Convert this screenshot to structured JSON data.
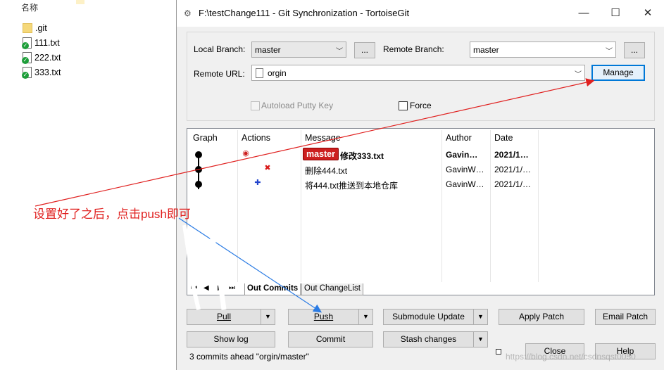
{
  "explorer": {
    "header": "名称",
    "items": [
      {
        "name": ".git",
        "icon": "folder-icon"
      },
      {
        "name": "111.txt",
        "icon": "txt-file-synced-icon"
      },
      {
        "name": "222.txt",
        "icon": "txt-file-synced-icon"
      },
      {
        "name": "333.txt",
        "icon": "txt-file-synced-icon"
      }
    ]
  },
  "dialog": {
    "title": "F:\\testChange111 - Git Synchronization - TortoiseGit",
    "local_branch_label": "Local Branch:",
    "local_branch_value": "master",
    "remote_branch_label": "Remote Branch:",
    "remote_branch_value": "master",
    "ellipsis": "...",
    "remote_url_label": "Remote URL:",
    "remote_url_value": "orgin",
    "manage_label": "Manage",
    "autoload_label": "Autoload Putty Key",
    "force_label": "Force",
    "columns": [
      "Graph",
      "Actions",
      "Message",
      "Author",
      "Date"
    ],
    "commits": [
      {
        "branch": "master",
        "message": "修改333.txt",
        "author": "Gavin…",
        "date": "2021/1…",
        "bold": true
      },
      {
        "branch": "",
        "message": "删除444.txt",
        "author": "GavinW…",
        "date": "2021/1/…",
        "bold": false
      },
      {
        "branch": "",
        "message": "将444.txt推送到本地仓库",
        "author": "GavinW…",
        "date": "2021/1/…",
        "bold": false
      }
    ],
    "tabs": {
      "out_commits": "Out Commits",
      "out_changelist": "Out ChangeList"
    },
    "buttons": {
      "pull": "Pull",
      "push": "Push",
      "submodule_update": "Submodule Update",
      "apply_patch": "Apply Patch",
      "email_patch": "Email Patch",
      "show_log": "Show log",
      "commit": "Commit",
      "stash_changes": "Stash changes",
      "close": "Close",
      "help": "Help"
    },
    "status": "3 commits ahead \"orgin/master\""
  },
  "annotation": {
    "note": "设置好了之后，点击push即可",
    "watermark": "https://blog.csdn.net/csdnsqst0050"
  },
  "colors": {
    "annotation_red": "#e0201f",
    "arrow_blue": "#2a7be4",
    "branch_badge": "#cc1f1f"
  }
}
